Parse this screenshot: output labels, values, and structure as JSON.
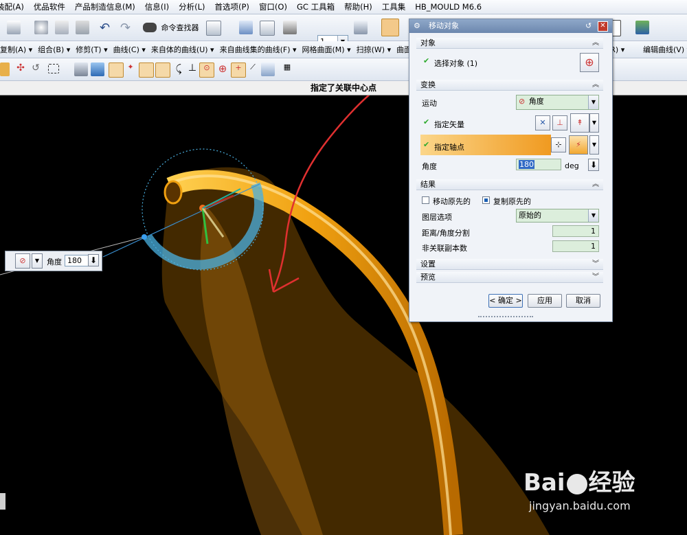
{
  "menu": [
    "装配(A)",
    "优品软件",
    "产品制造信息(M)",
    "信息(I)",
    "分析(L)",
    "首选项(P)",
    "窗口(O)",
    "GC 工具箱",
    "帮助(H)",
    "工具集",
    "HB_MOULD M6.6"
  ],
  "toolbar1": {
    "cmd_finder": "命令查找器",
    "layer_value": "1"
  },
  "toolbar2": [
    "复制(A) ▾",
    "组合(B) ▾",
    "修剪(T) ▾",
    "曲线(C) ▾",
    "来自体的曲线(U) ▾",
    "来自曲线集的曲线(F) ▾",
    "网格曲面(M) ▾",
    "扫掠(W) ▾",
    "曲面",
    "曲面(R) ▾",
    "编辑曲线(V) ▾"
  ],
  "status_text": "指定了关联中心点",
  "float_widget": {
    "label": "角度",
    "value": "180"
  },
  "dialog": {
    "title": "移动对象",
    "sections": {
      "object": "对象",
      "transform": "变换",
      "result": "结果",
      "settings": "设置",
      "preview": "预览"
    },
    "select_object": "选择对象 (1)",
    "motion_label": "运动",
    "motion_value": "角度",
    "specify_vector": "指定矢量",
    "specify_pivot": "指定轴点",
    "angle_label": "角度",
    "angle_value": "180",
    "angle_unit": "deg",
    "move_original": "移动原先的",
    "copy_original": "复制原先的",
    "layer_option_label": "图层选项",
    "layer_option_value": "原始的",
    "distance_angle_div_label": "距离/角度分割",
    "distance_angle_div_value": "1",
    "unassoc_copies_label": "非关联副本数",
    "unassoc_copies_value": "1",
    "ok": "< 确定 >",
    "apply": "应用",
    "cancel": "取消"
  },
  "watermark": {
    "brand": "Bai",
    "brand2": "经验",
    "url": "jingyan.baidu.com"
  },
  "colors": {
    "pipe": "#f0a010",
    "surface": "#7a4a00",
    "arrow": "#e03030",
    "dial": "#4ab0e0",
    "pivot_highlight": "#f0a020"
  }
}
